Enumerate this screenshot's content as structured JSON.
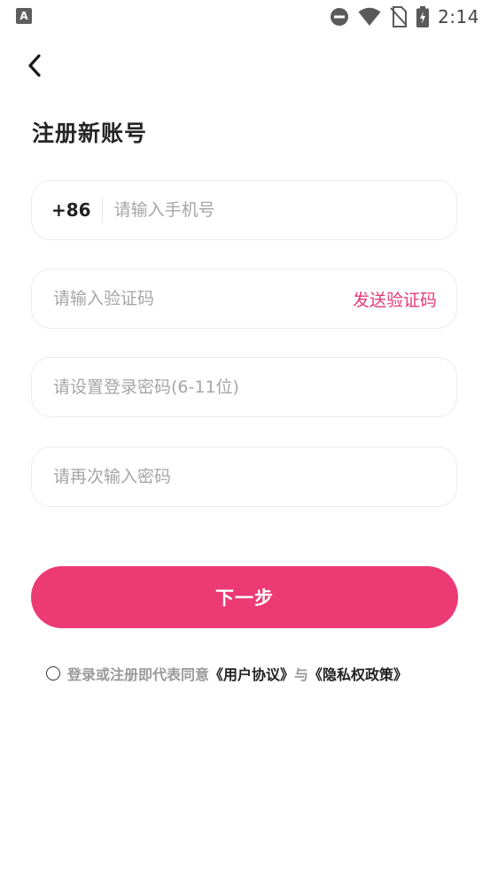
{
  "status_bar": {
    "app_icon_label": "A",
    "time": "2:14"
  },
  "header": {
    "title": "注册新账号"
  },
  "form": {
    "country_code": "+86",
    "phone_placeholder": "请输入手机号",
    "code_placeholder": "请输入验证码",
    "send_code_label": "发送验证码",
    "password_placeholder": "请设置登录密码(6-11位)",
    "confirm_password_placeholder": "请再次输入密码"
  },
  "actions": {
    "next_label": "下一步"
  },
  "agreement": {
    "prefix": "登录或注册即代表同意",
    "user_agreement": "《用户协议》",
    "joiner": "与",
    "privacy_policy": "《隐私权政策》"
  },
  "colors": {
    "accent": "#ec3a74",
    "link_accent": "#e43a76"
  }
}
